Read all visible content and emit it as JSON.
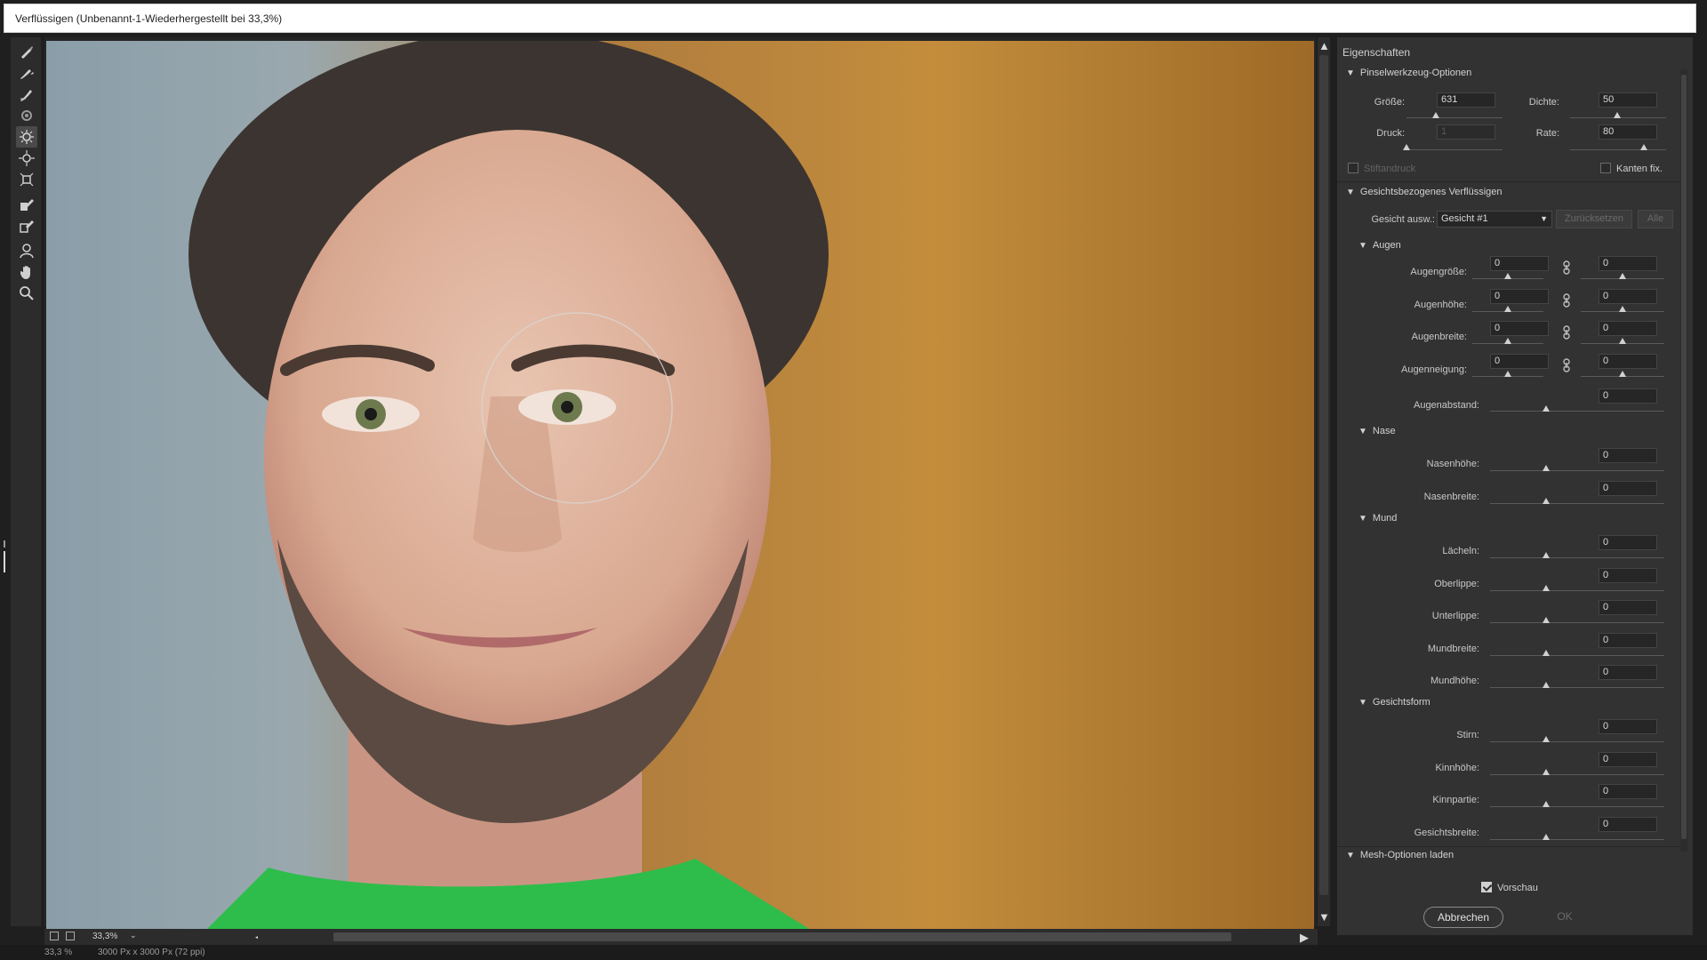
{
  "window": {
    "title": "Verflüssigen (Unbenannt-1-Wiederhergestellt bei 33,3%)"
  },
  "tools": [
    {
      "name": "vorwaerts-krumm-tool",
      "icon": "warp-brush-icon"
    },
    {
      "name": "rekonstruktion-tool",
      "icon": "reconstruct-brush-icon"
    },
    {
      "name": "glaetten-tool",
      "icon": "smooth-brush-icon"
    },
    {
      "name": "strudel-tool",
      "icon": "twirl-icon"
    },
    {
      "name": "zusammenziehen-tool",
      "icon": "pucker-icon"
    },
    {
      "name": "aufblasen-tool",
      "icon": "bloat-icon"
    },
    {
      "name": "links-schieben-tool",
      "icon": "push-left-icon"
    },
    {
      "name": "fixieren-tool",
      "icon": "freeze-mask-icon"
    },
    {
      "name": "fixierung-aufheben-tool",
      "icon": "thaw-mask-icon"
    },
    {
      "name": "gesicht-tool",
      "icon": "face-icon"
    },
    {
      "name": "hand-tool",
      "icon": "hand-icon"
    },
    {
      "name": "zoom-tool",
      "icon": "zoom-icon"
    }
  ],
  "statusbar": {
    "zoom": "33,3%",
    "doc_info_left": "33,3 %",
    "doc_info": "3000 Px x 3000 Px (72 ppi)"
  },
  "panel": {
    "header": "Eigenschaften",
    "brush_section": "Pinselwerkzeug-Optionen",
    "groesse_label": "Größe:",
    "groesse_value": "631",
    "dichte_label": "Dichte:",
    "dichte_value": "50",
    "druck_label": "Druck:",
    "druck_value": "1",
    "rate_label": "Rate:",
    "rate_value": "80",
    "stiftandruck_label": "Stiftandruck",
    "kanten_label": "Kanten fix.",
    "face_section": "Gesichtsbezogenes Verflüssigen",
    "gesicht_label": "Gesicht ausw.:",
    "gesicht_value": "Gesicht #1",
    "reset_label": "Zurücksetzen",
    "alle_label": "Alle",
    "augen_section": "Augen",
    "augen_rows": [
      {
        "label": "Augengröße:",
        "left": "0",
        "right": "0"
      },
      {
        "label": "Augenhöhe:",
        "left": "0",
        "right": "0"
      },
      {
        "label": "Augenbreite:",
        "left": "0",
        "right": "0"
      },
      {
        "label": "Augenneigung:",
        "left": "0",
        "right": "0"
      }
    ],
    "augenabstand_label": "Augenabstand:",
    "augenabstand_value": "0",
    "nase_section": "Nase",
    "nase_rows": [
      {
        "label": "Nasenhöhe:",
        "value": "0"
      },
      {
        "label": "Nasenbreite:",
        "value": "0"
      }
    ],
    "mund_section": "Mund",
    "mund_rows": [
      {
        "label": "Lächeln:",
        "value": "0"
      },
      {
        "label": "Oberlippe:",
        "value": "0"
      },
      {
        "label": "Unterlippe:",
        "value": "0"
      },
      {
        "label": "Mundbreite:",
        "value": "0"
      },
      {
        "label": "Mundhöhe:",
        "value": "0"
      }
    ],
    "gesichtsform_section": "Gesichtsform",
    "gesichtsform_rows": [
      {
        "label": "Stirn:",
        "value": "0"
      },
      {
        "label": "Kinnhöhe:",
        "value": "0"
      },
      {
        "label": "Kinnpartie:",
        "value": "0"
      },
      {
        "label": "Gesichtsbreite:",
        "value": "0"
      }
    ],
    "mesh_section": "Mesh-Optionen laden",
    "vorschau_label": "Vorschau",
    "cancel_label": "Abbrechen",
    "ok_label": "OK"
  },
  "colors": {
    "panel_bg": "#323232",
    "canvas_bg": "#262626",
    "shirt": "#2ebd4b"
  }
}
